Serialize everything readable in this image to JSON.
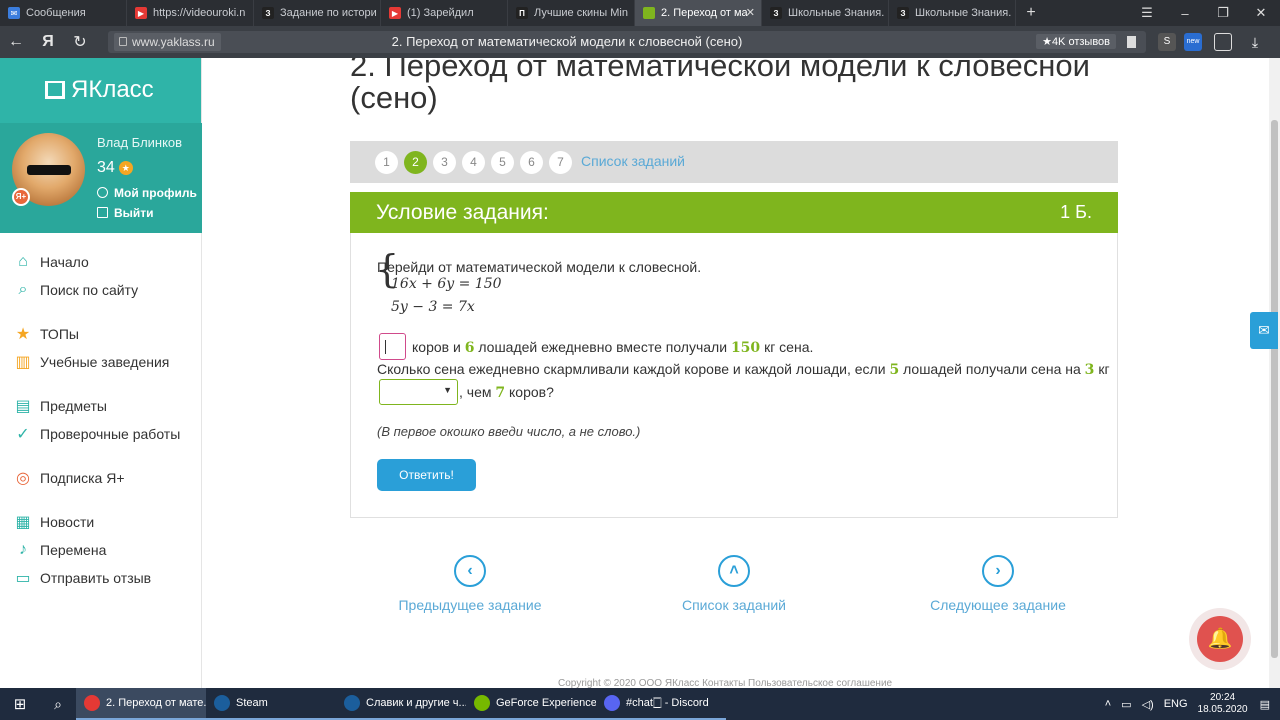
{
  "browser": {
    "tabs": [
      {
        "label": "Сообщения",
        "color": "#3b7ddd",
        "glyph": "✉"
      },
      {
        "label": "https://videouroki.n",
        "color": "#e53935",
        "glyph": "▶"
      },
      {
        "label": "Задание по истори",
        "color": "#222222",
        "glyph": "З"
      },
      {
        "label": "(1) Зарейдил",
        "color": "#e53935",
        "glyph": "▶"
      },
      {
        "label": "Лучшие скины Min",
        "color": "#222222",
        "glyph": "П"
      },
      {
        "label": "2. Переход от ма",
        "color": "#7fb51e",
        "glyph": ""
      },
      {
        "label": "Школьные Знания.",
        "color": "#222222",
        "glyph": "З"
      },
      {
        "label": "Школьные Знания.",
        "color": "#222222",
        "glyph": "З"
      }
    ],
    "url_host": "www.yaklass.ru",
    "page_title": "2. Переход от математической модели к словесной (сено)",
    "reviews_badge": "★4K отзывов"
  },
  "sidebar": {
    "logo": "ЯКласс",
    "user": {
      "name": "Влад Блинков",
      "points": "34",
      "profile": "Мой профиль",
      "logout": "Выйти",
      "badge": "Я+"
    },
    "menu": [
      {
        "label": "Начало",
        "icon": "home-icon",
        "color": "#2fb4a8"
      },
      {
        "label": "Поиск по сайту",
        "icon": "search-icon",
        "color": "#2fb4a8"
      },
      {
        "label": "ТОПы",
        "icon": "star-icon",
        "color": "#f5a623"
      },
      {
        "label": "Учебные заведения",
        "icon": "school-icon",
        "color": "#f5a623"
      },
      {
        "label": "Предметы",
        "icon": "subjects-icon",
        "color": "#2fb4a8"
      },
      {
        "label": "Проверочные работы",
        "icon": "check-icon",
        "color": "#2fb4a8"
      },
      {
        "label": "Подписка Я+",
        "icon": "subscription-icon",
        "color": "#e8673b"
      },
      {
        "label": "Новости",
        "icon": "news-icon",
        "color": "#2fb4a8"
      },
      {
        "label": "Перемена",
        "icon": "bell-icon",
        "color": "#2fb4a8"
      },
      {
        "label": "Отправить отзыв",
        "icon": "feedback-icon",
        "color": "#2fb4a8"
      }
    ]
  },
  "content": {
    "title": "2. Переход от математической модели к словесной (сено)",
    "pager": {
      "pages": [
        "1",
        "2",
        "3",
        "4",
        "5",
        "6",
        "7"
      ],
      "current": "2",
      "list_link": "Список заданий"
    },
    "condition": {
      "title": "Условие задания:",
      "score": "1 Б."
    },
    "task": {
      "intro": "Перейди от математической модели к словесной.",
      "eq1": "16x + 6y = 150",
      "eq2": "5y − 3 = 7x",
      "line1_a": "коров и",
      "line1_n1": "6",
      "line1_b": "лошадей ежедневно вместе получали",
      "line1_n2": "150",
      "line1_c": "кг сена.",
      "line2_a": "Сколько сена ежедневно скармливали каждой корове и каждой лошади, если",
      "line2_n1": "5",
      "line2_b": "лошадей получали сена на",
      "line2_n2": "3",
      "line2_c": "кг",
      "line3_a": ", чем",
      "line3_n": "7",
      "line3_b": "коров?",
      "hint": "(В первое окошко введи число, а не слово.)",
      "answer_button": "Ответить!"
    },
    "nav": {
      "prev": "Предыдущее задание",
      "list": "Список заданий",
      "next": "Следующее задание"
    },
    "footer": "Copyright © 2020 ООО ЯКласс    Контакты    Пользовательское соглашение"
  },
  "taskbar": {
    "items": [
      {
        "label": "2. Переход от мате...",
        "color": "#e53935"
      },
      {
        "label": "Steam",
        "color": "#1b5e9c"
      },
      {
        "label": "Славик и другие ч...",
        "color": "#1b5e9c"
      },
      {
        "label": "GeForce Experience",
        "color": "#76b900"
      },
      {
        "label": "#chat🀆 - Discord",
        "color": "#5865f2"
      }
    ],
    "lang": "ENG",
    "time": "20:24",
    "date": "18.05.2020"
  }
}
